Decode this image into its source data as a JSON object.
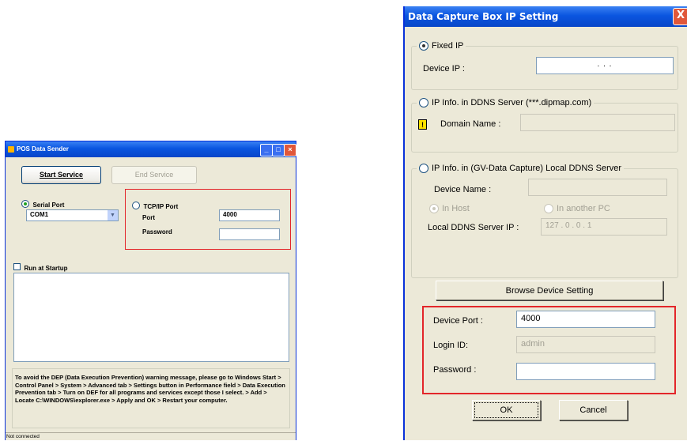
{
  "pos_window": {
    "title": "POS Data Sender",
    "start_service": "Start Service",
    "end_service": "End Service",
    "serial_port_label": "Serial Port",
    "serial_port_value": "COM1",
    "tcpip_label": "TCP/IP Port",
    "port_label": "Port",
    "port_value": "4000",
    "password_label": "Password",
    "password_value": "",
    "run_at_startup": "Run at Startup",
    "dep_message": "To avoid the DEP (Data Execution Prevention) warning message, please go to Windows Start > Control Panel > System > Advanced tab > Settings button in Performance field > Data Execution Prevention tab > Turn on DEF for all programs and services except those I select. > Add > Locate C:\\WINDOWS\\explorer.exe > Apply and OK > Restart your computer.",
    "status": "Not connected"
  },
  "ip_dialog": {
    "title": "Data Capture Box IP Setting",
    "close": "X",
    "fixed_ip_label": "Fixed IP",
    "device_ip_label": "Device IP :",
    "device_ip_value": ".          .          .",
    "ddns_label": "IP Info. in DDNS Server (***.dipmap.com)",
    "domain_name_label": "Domain Name :",
    "warn_icon": "!",
    "local_ddns_label": "IP Info. in (GV-Data Capture) Local DDNS Server",
    "device_name_label": "Device Name :",
    "in_host": "In Host",
    "in_another_pc": "In another PC",
    "local_ddns_ip_label": "Local DDNS Server IP :",
    "local_ddns_ip_value": "127  .   0   .   0   .   1",
    "browse_button": "Browse Device Setting",
    "device_port_label": "Device Port :",
    "device_port_value": "4000",
    "login_id_label": "Login ID:",
    "login_id_value": "admin",
    "password_label": "Password :",
    "password_value": "",
    "ok": "OK",
    "cancel": "Cancel"
  },
  "colors": {
    "highlight_red": "#e3262a",
    "xp_blue": "#0a55e0"
  }
}
